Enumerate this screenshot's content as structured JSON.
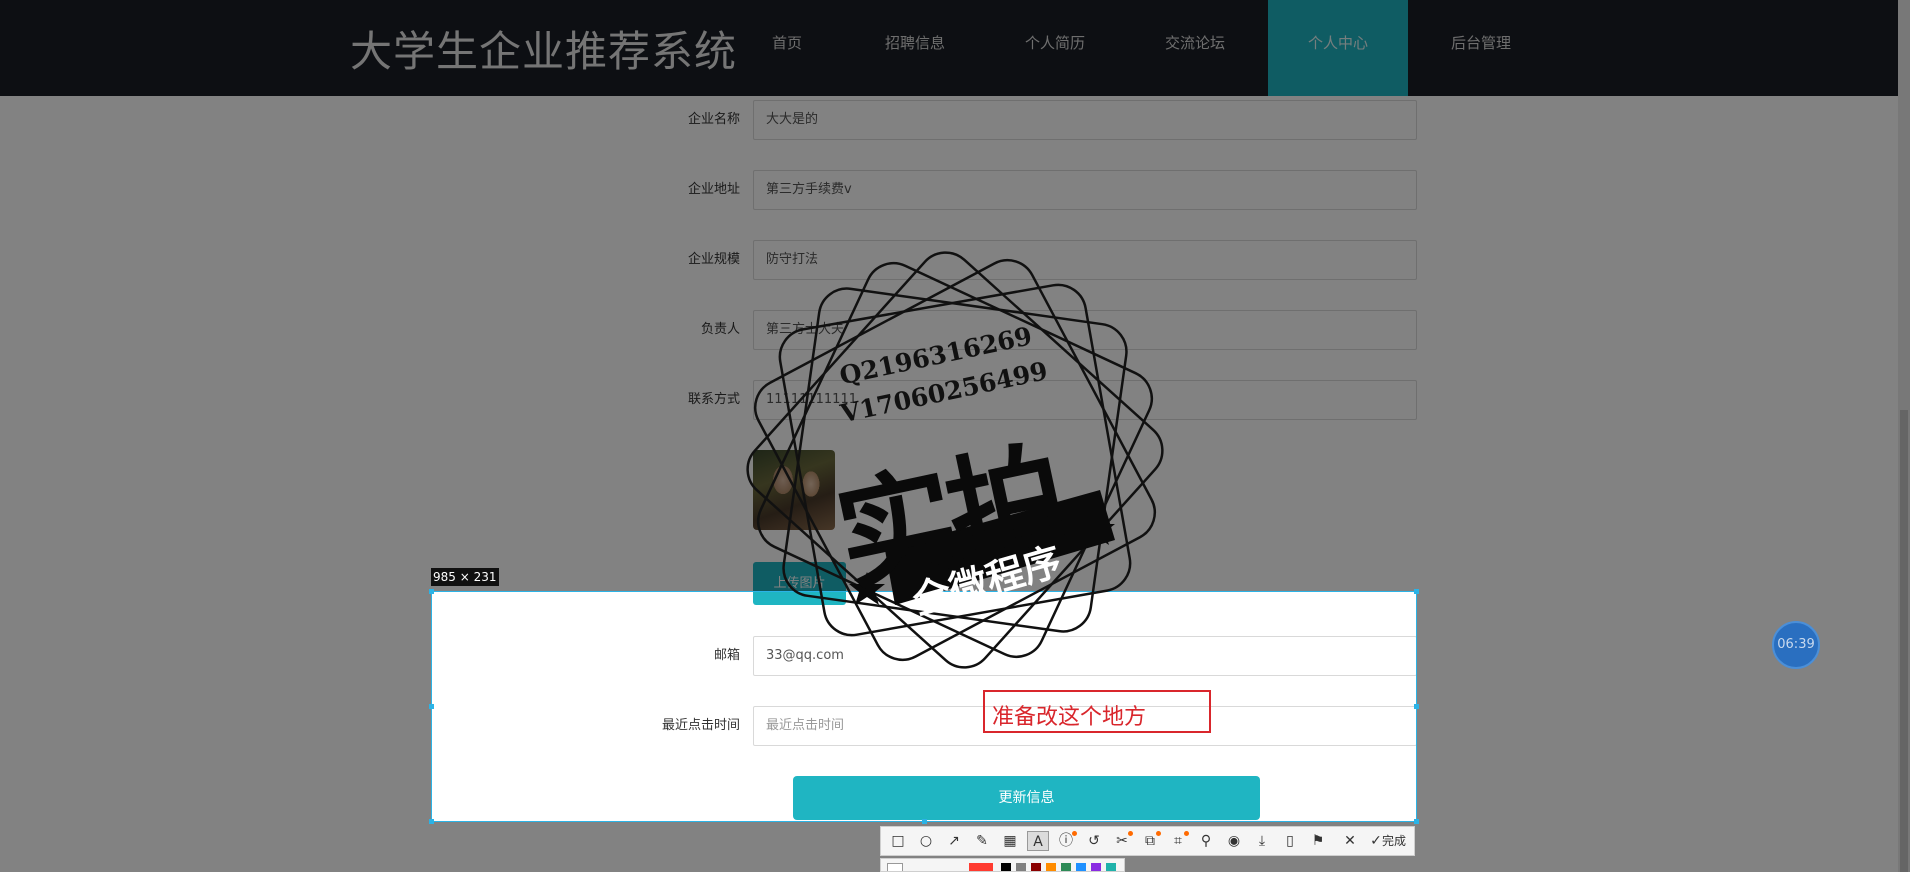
{
  "header": {
    "brand": "大学生企业推荐系统",
    "nav": [
      {
        "label": "首页"
      },
      {
        "label": "招聘信息"
      },
      {
        "label": "个人简历"
      },
      {
        "label": "交流论坛"
      },
      {
        "label": "个人中心",
        "active": true
      },
      {
        "label": "后台管理"
      }
    ]
  },
  "form": {
    "company_name": {
      "label": "企业名称",
      "value": "大大是的"
    },
    "company_address": {
      "label": "企业地址",
      "value": "第三方手续费v"
    },
    "company_size": {
      "label": "企业规模",
      "value": "防守打法"
    },
    "manager": {
      "label": "负责人",
      "value": "第三方士大夫"
    },
    "contact": {
      "label": "联系方式",
      "value": "11111111111"
    },
    "upload_label": "上传图片",
    "email": {
      "label": "邮箱",
      "value": "33@qq.com"
    },
    "last_click_time": {
      "label": "最近点击时间",
      "placeholder": "最近点击时间"
    },
    "submit_label": "更新信息"
  },
  "screenshot_overlay": {
    "size_label": "985 × 231",
    "annotation": "准备改这个地方",
    "done_label": "完成",
    "tools": [
      "rectangle-icon",
      "ellipse-icon",
      "arrow-icon",
      "pencil-icon",
      "mosaic-icon",
      "text-icon",
      "serial-number-icon",
      "undo-icon",
      "ocr-icon",
      "translate-icon",
      "scan-icon",
      "pin-icon",
      "record-icon",
      "save-icon",
      "phone-icon",
      "bookmark-icon",
      "close-icon",
      "check-icon"
    ],
    "palette_colors": [
      "#ff3b30",
      "#ffffff",
      "#000000",
      "#808080",
      "#8b0000",
      "#ff8c00",
      "#2e8b57",
      "#1e90ff",
      "#8a2be2",
      "#20b2aa"
    ]
  },
  "watermark": {
    "qq": "Q2196316269",
    "wechat": "V17060256499",
    "big": "实拍",
    "banner": "全微程序"
  },
  "timer": "06:39",
  "colors": {
    "accent": "#1fb5c2",
    "navbar": "#1a1e26",
    "annotation": "#d9262c",
    "selection": "#2bb3e6"
  }
}
